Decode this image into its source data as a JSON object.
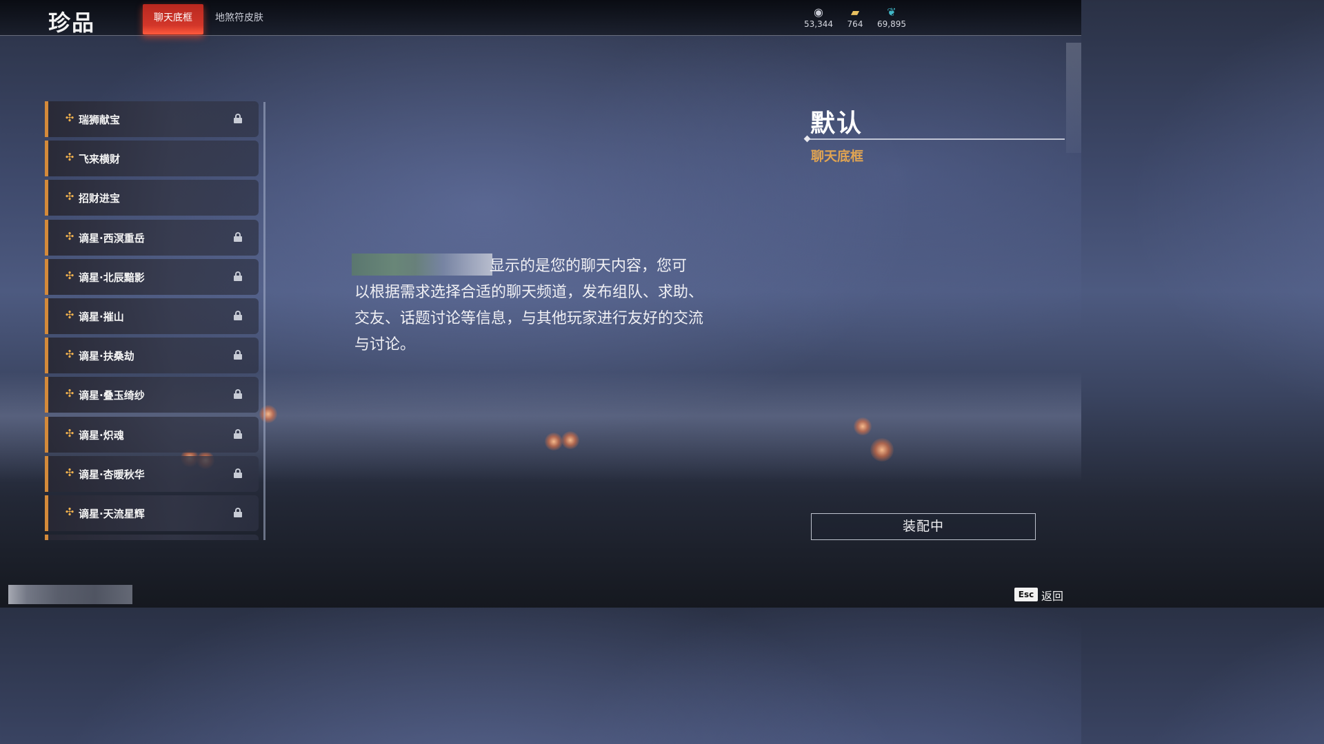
{
  "page_title": "珍品",
  "tabs": [
    {
      "label": "聊天底框",
      "active": true
    },
    {
      "label": "地煞符皮肤",
      "active": false
    }
  ],
  "currencies": [
    {
      "icon": "coin-icon",
      "glyph": "◉",
      "value": "53,344"
    },
    {
      "icon": "ticket-icon",
      "glyph": "▰",
      "value": "764"
    },
    {
      "icon": "feather-icon",
      "glyph": "❦",
      "value": "69,895"
    }
  ],
  "list_items": [
    {
      "label": "瑞狮献宝",
      "locked": true
    },
    {
      "label": "飞来横财",
      "locked": false
    },
    {
      "label": "招财进宝",
      "locked": false
    },
    {
      "label": "谪星·西溟重岳",
      "locked": true
    },
    {
      "label": "谪星·北辰黯影",
      "locked": true
    },
    {
      "label": "谪星·摧山",
      "locked": true
    },
    {
      "label": "谪星·扶桑劫",
      "locked": true
    },
    {
      "label": "谪星·叠玉绮纱",
      "locked": true
    },
    {
      "label": "谪星·炽魂",
      "locked": true
    },
    {
      "label": "谪星·杏暖秋华",
      "locked": true
    },
    {
      "label": "谪星·天流星辉",
      "locked": true
    }
  ],
  "preview": {
    "line1": "显示的是您的聊天内容，您可",
    "rest": "以根据需求选择合适的聊天频道，发布组队、求助、交友、话题讨论等信息，与其他玩家进行友好的交流与讨论。"
  },
  "detail": {
    "name": "默认",
    "category": "聊天底框",
    "equip_button": "装配中"
  },
  "footer": {
    "key": "Esc",
    "back": "返回"
  },
  "colors": {
    "accent_red": "#d2362a",
    "accent_gold": "#e0a452",
    "item_border": "#d48a3a"
  }
}
